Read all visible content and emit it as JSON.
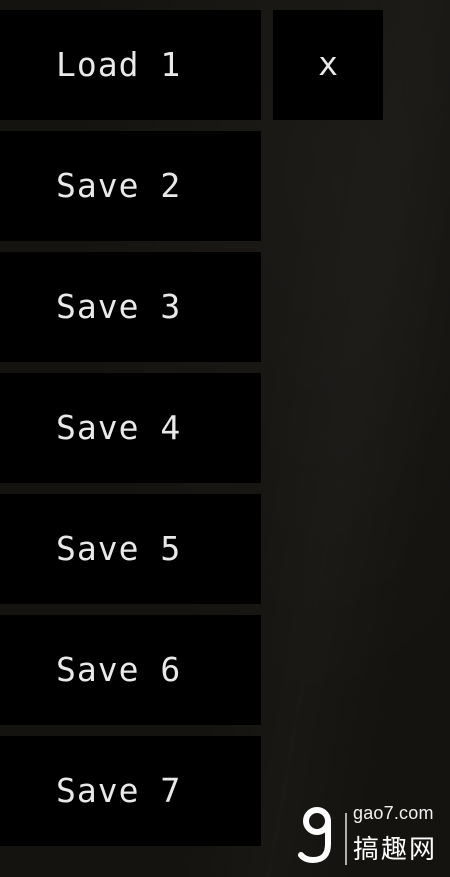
{
  "menu": {
    "slots": [
      {
        "label": "Load 1"
      },
      {
        "label": "Save 2"
      },
      {
        "label": "Save 3"
      },
      {
        "label": "Save 4"
      },
      {
        "label": "Save 5"
      },
      {
        "label": "Save 6"
      },
      {
        "label": "Save 7"
      }
    ],
    "close_label": "x"
  },
  "watermark": {
    "domain": "gao7.com",
    "site_name": "搞趣网",
    "logo_icon": "g-logo-icon"
  },
  "colors": {
    "background": "#151310",
    "button": "#000000",
    "text": "#e9e9e9"
  }
}
